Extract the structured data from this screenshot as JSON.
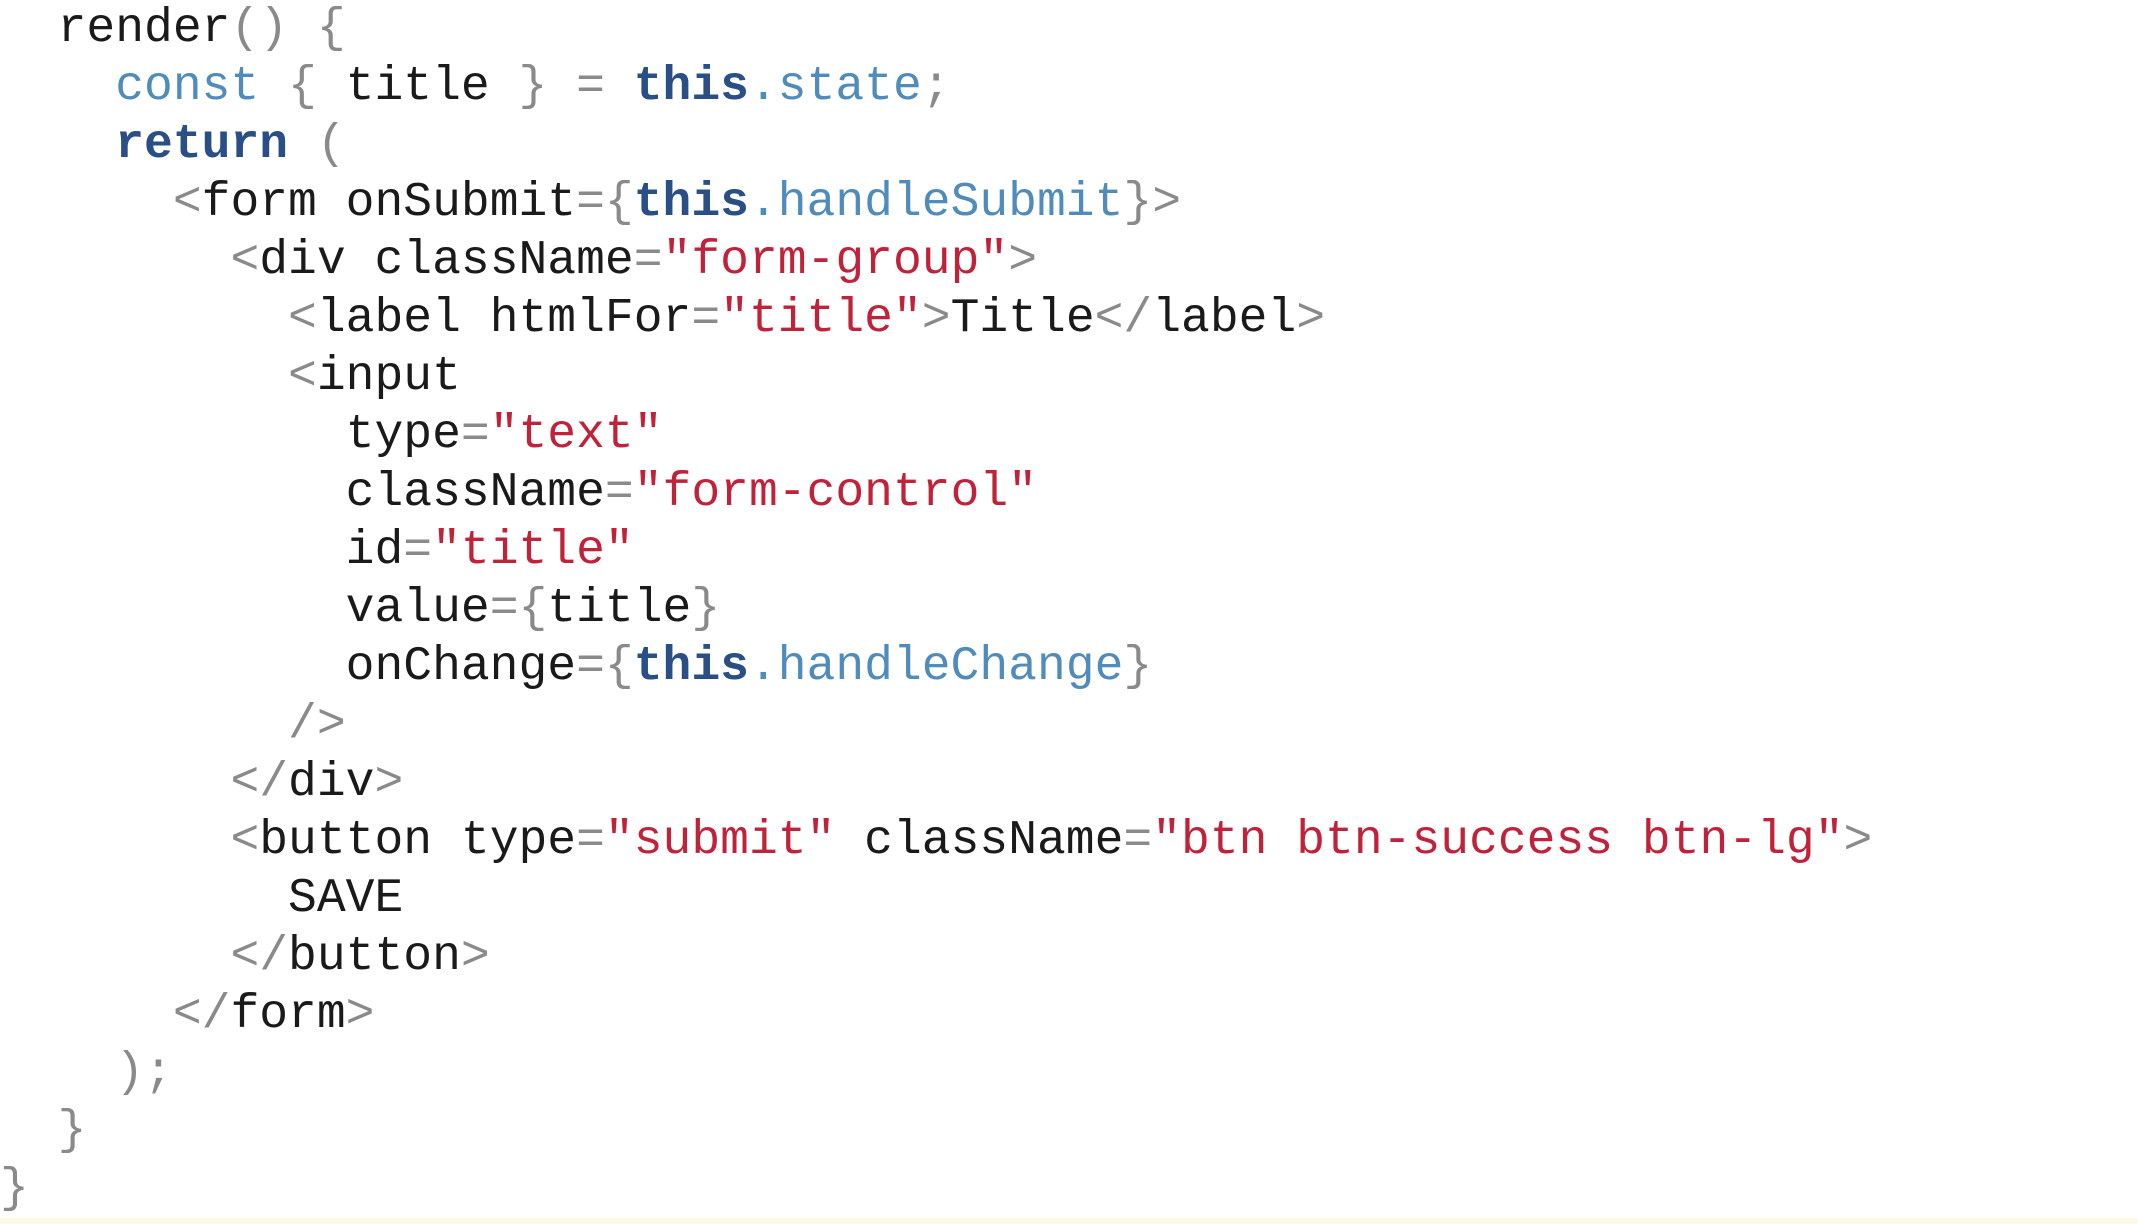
{
  "colors": {
    "text": "#1a1a1a",
    "keyword": "#2a4f86",
    "declaration": "#4f8cbb",
    "string": "#c0223a",
    "punctuation": "#8a8a8a",
    "property": "#4f8cbb",
    "background": "#ffffff",
    "bottom_strip": "#fdf8e7"
  },
  "code": {
    "language": "jsx",
    "lines": [
      [
        {
          "t": "  render",
          "k": "text"
        },
        {
          "t": "() {",
          "k": "punct"
        }
      ],
      [
        {
          "t": "    ",
          "k": "text"
        },
        {
          "t": "const",
          "k": "decl"
        },
        {
          "t": " { ",
          "k": "punct"
        },
        {
          "t": "title",
          "k": "text"
        },
        {
          "t": " } = ",
          "k": "punct"
        },
        {
          "t": "this",
          "k": "keyword"
        },
        {
          "t": ".state",
          "k": "prop"
        },
        {
          "t": ";",
          "k": "punct"
        }
      ],
      [
        {
          "t": "    ",
          "k": "text"
        },
        {
          "t": "return",
          "k": "keyword"
        },
        {
          "t": " (",
          "k": "punct"
        }
      ],
      [
        {
          "t": "      ",
          "k": "text"
        },
        {
          "t": "<",
          "k": "punct"
        },
        {
          "t": "form onSubmit",
          "k": "text"
        },
        {
          "t": "={",
          "k": "punct"
        },
        {
          "t": "this",
          "k": "keyword"
        },
        {
          "t": ".handleSubmit",
          "k": "prop"
        },
        {
          "t": "}>",
          "k": "punct"
        }
      ],
      [
        {
          "t": "        ",
          "k": "text"
        },
        {
          "t": "<",
          "k": "punct"
        },
        {
          "t": "div className",
          "k": "text"
        },
        {
          "t": "=",
          "k": "punct"
        },
        {
          "t": "\"form-group\"",
          "k": "string"
        },
        {
          "t": ">",
          "k": "punct"
        }
      ],
      [
        {
          "t": "          ",
          "k": "text"
        },
        {
          "t": "<",
          "k": "punct"
        },
        {
          "t": "label htmlFor",
          "k": "text"
        },
        {
          "t": "=",
          "k": "punct"
        },
        {
          "t": "\"title\"",
          "k": "string"
        },
        {
          "t": ">",
          "k": "punct"
        },
        {
          "t": "Title",
          "k": "text"
        },
        {
          "t": "</",
          "k": "punct"
        },
        {
          "t": "label",
          "k": "text"
        },
        {
          "t": ">",
          "k": "punct"
        }
      ],
      [
        {
          "t": "          ",
          "k": "text"
        },
        {
          "t": "<",
          "k": "punct"
        },
        {
          "t": "input",
          "k": "text"
        }
      ],
      [
        {
          "t": "            type",
          "k": "text"
        },
        {
          "t": "=",
          "k": "punct"
        },
        {
          "t": "\"text\"",
          "k": "string"
        }
      ],
      [
        {
          "t": "            className",
          "k": "text"
        },
        {
          "t": "=",
          "k": "punct"
        },
        {
          "t": "\"form-control\"",
          "k": "string"
        }
      ],
      [
        {
          "t": "            id",
          "k": "text"
        },
        {
          "t": "=",
          "k": "punct"
        },
        {
          "t": "\"title\"",
          "k": "string"
        }
      ],
      [
        {
          "t": "            value",
          "k": "text"
        },
        {
          "t": "={",
          "k": "punct"
        },
        {
          "t": "title",
          "k": "text"
        },
        {
          "t": "}",
          "k": "punct"
        }
      ],
      [
        {
          "t": "            onChange",
          "k": "text"
        },
        {
          "t": "={",
          "k": "punct"
        },
        {
          "t": "this",
          "k": "keyword"
        },
        {
          "t": ".handleChange",
          "k": "prop"
        },
        {
          "t": "}",
          "k": "punct"
        }
      ],
      [
        {
          "t": "          ",
          "k": "text"
        },
        {
          "t": "/>",
          "k": "punct"
        }
      ],
      [
        {
          "t": "        ",
          "k": "text"
        },
        {
          "t": "</",
          "k": "punct"
        },
        {
          "t": "div",
          "k": "text"
        },
        {
          "t": ">",
          "k": "punct"
        }
      ],
      [
        {
          "t": "        ",
          "k": "text"
        },
        {
          "t": "<",
          "k": "punct"
        },
        {
          "t": "button type",
          "k": "text"
        },
        {
          "t": "=",
          "k": "punct"
        },
        {
          "t": "\"submit\"",
          "k": "string"
        },
        {
          "t": " className",
          "k": "text"
        },
        {
          "t": "=",
          "k": "punct"
        },
        {
          "t": "\"btn btn-success btn-lg\"",
          "k": "string"
        },
        {
          "t": ">",
          "k": "punct"
        }
      ],
      [
        {
          "t": "          SAVE",
          "k": "text"
        }
      ],
      [
        {
          "t": "        ",
          "k": "text"
        },
        {
          "t": "</",
          "k": "punct"
        },
        {
          "t": "button",
          "k": "text"
        },
        {
          "t": ">",
          "k": "punct"
        }
      ],
      [
        {
          "t": "      ",
          "k": "text"
        },
        {
          "t": "</",
          "k": "punct"
        },
        {
          "t": "form",
          "k": "text"
        },
        {
          "t": ">",
          "k": "punct"
        }
      ],
      [
        {
          "t": "    ",
          "k": "text"
        },
        {
          "t": ");",
          "k": "punct"
        }
      ],
      [
        {
          "t": "  ",
          "k": "text"
        },
        {
          "t": "}",
          "k": "punct"
        }
      ],
      [
        {
          "t": "}",
          "k": "punct"
        }
      ]
    ]
  }
}
